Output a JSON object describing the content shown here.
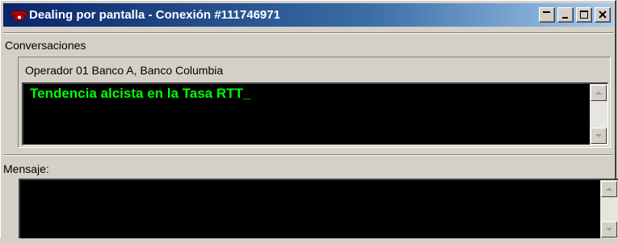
{
  "window": {
    "title": "Dealing por pantalla - Conexión #111746971",
    "icon": "telephone-icon",
    "controls": [
      "help-button-icon",
      "minimize-icon",
      "maximize-icon",
      "close-icon"
    ]
  },
  "conversations": {
    "section_label": "Conversaciones",
    "participants": "Operador 01 Banco A, Banco Columbia",
    "message_text": "Tendencia alcista en la Tasa RTT_"
  },
  "message": {
    "section_label": "Mensaje:",
    "value": ""
  },
  "colors": {
    "title_bar_start": "#0a246a",
    "title_bar_end": "#a6caf0",
    "conversation_text": "#00ff00",
    "text_area_background": "#000000",
    "window_background": "#d4d0c8"
  }
}
